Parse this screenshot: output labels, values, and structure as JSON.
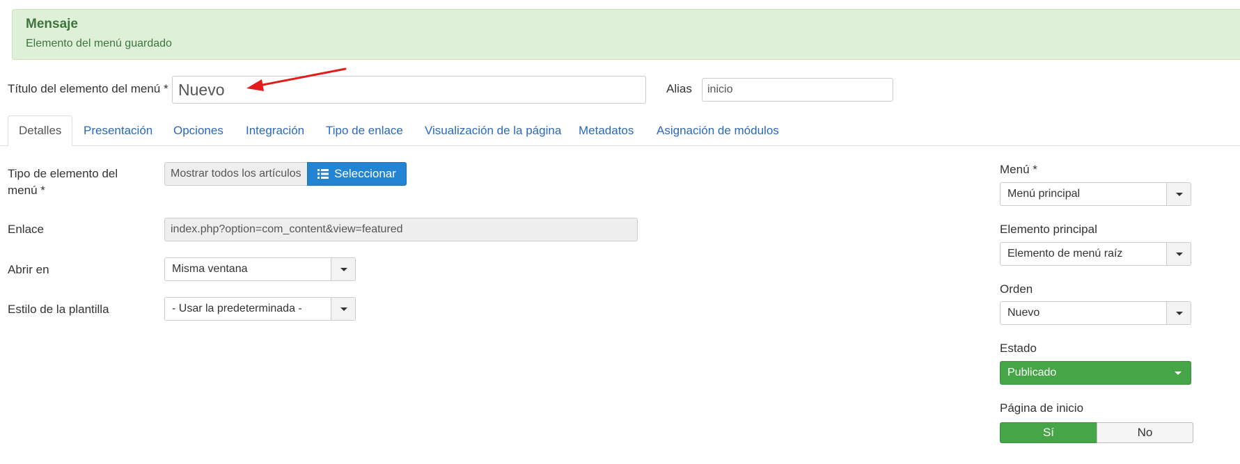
{
  "message": {
    "heading": "Mensaje",
    "text": "Elemento del menú guardado"
  },
  "title_row": {
    "title_label": "Título del elemento del menú *",
    "title_value": "Nuevo",
    "alias_label": "Alias",
    "alias_value": "inicio"
  },
  "tabs": [
    {
      "label": "Detalles",
      "active": true
    },
    {
      "label": "Presentación"
    },
    {
      "label": "Opciones"
    },
    {
      "label": "Integración"
    },
    {
      "label": "Tipo de enlace"
    },
    {
      "label": "Visualización de la página"
    },
    {
      "label": "Metadatos"
    },
    {
      "label": "Asignación de módulos"
    }
  ],
  "details": {
    "item_type_label": "Tipo de elemento del menú *",
    "item_type_value": "Mostrar todos los artículos",
    "select_button": "Seleccionar",
    "link_label": "Enlace",
    "link_value": "index.php?option=com_content&view=featured",
    "open_in_label": "Abrir en",
    "open_in_value": "Misma ventana",
    "template_style_label": "Estilo de la plantilla",
    "template_style_value": "- Usar la predeterminada -"
  },
  "sidebar": {
    "menu_label": "Menú *",
    "menu_value": "Menú principal",
    "parent_label": "Elemento principal",
    "parent_value": "Elemento de menú raíz",
    "order_label": "Orden",
    "order_value": "Nuevo",
    "status_label": "Estado",
    "status_value": "Publicado",
    "home_label": "Página de inicio",
    "home_yes": "Sí",
    "home_no": "No"
  },
  "colors": {
    "message_bg": "#dff0d8",
    "message_text": "#3c763d",
    "link": "#2a69b8",
    "primary": "#2384d3",
    "success": "#46a546",
    "annotation_arrow": "#e31b1b"
  }
}
